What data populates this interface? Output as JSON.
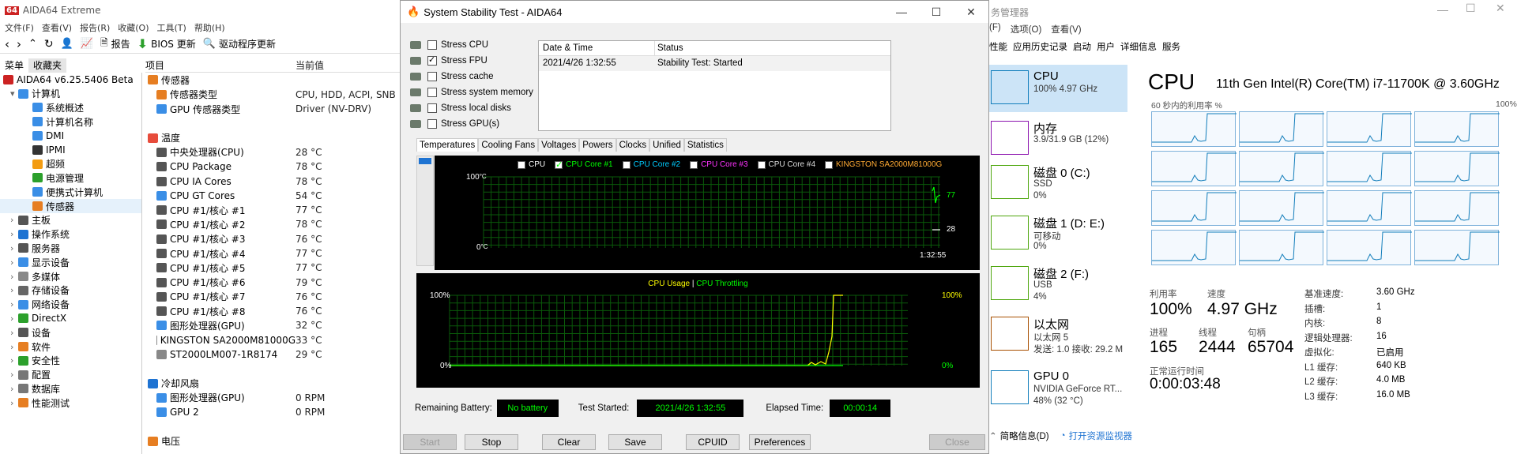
{
  "aida": {
    "title": "AIDA64 Extreme",
    "menu": [
      "文件(F)",
      "查看(V)",
      "报告(R)",
      "收藏(O)",
      "工具(T)",
      "帮助(H)"
    ],
    "toolbar": {
      "report": "报告",
      "bios": "BIOS 更新",
      "driver": "驱动程序更新"
    },
    "panel_tabs": [
      "菜单",
      "收藏夹"
    ],
    "tree": [
      {
        "label": "AIDA64 v6.25.5406 Beta",
        "indent": 0,
        "icon": "aida-logo-icon",
        "color": "#c22"
      },
      {
        "label": "计算机",
        "indent": 1,
        "icon": "computer-icon",
        "color": "#3a8ee6",
        "exp": "▾"
      },
      {
        "label": "系统概述",
        "indent": 3,
        "icon": "computer-icon",
        "color": "#3a8ee6"
      },
      {
        "label": "计算机名称",
        "indent": 3,
        "icon": "computer-icon",
        "color": "#3a8ee6"
      },
      {
        "label": "DMI",
        "indent": 3,
        "icon": "chip-icon",
        "color": "#3a8ee6"
      },
      {
        "label": "IPMI",
        "indent": 3,
        "icon": "ipmi-icon",
        "color": "#333"
      },
      {
        "label": "超频",
        "indent": 3,
        "icon": "flame-icon",
        "color": "#f39c12"
      },
      {
        "label": "电源管理",
        "indent": 3,
        "icon": "power-icon",
        "color": "#2ca02c"
      },
      {
        "label": "便携式计算机",
        "indent": 3,
        "icon": "laptop-icon",
        "color": "#3a8ee6"
      },
      {
        "label": "传感器",
        "indent": 3,
        "icon": "sensor-icon",
        "color": "#e67e22",
        "selected": true
      },
      {
        "label": "主板",
        "indent": 1,
        "icon": "motherboard-icon",
        "color": "#555",
        "exp": "›"
      },
      {
        "label": "操作系统",
        "indent": 1,
        "icon": "windows-icon",
        "color": "#1e73d2",
        "exp": "›"
      },
      {
        "label": "服务器",
        "indent": 1,
        "icon": "server-icon",
        "color": "#555",
        "exp": "›"
      },
      {
        "label": "显示设备",
        "indent": 1,
        "icon": "display-icon",
        "color": "#3a8ee6",
        "exp": "›"
      },
      {
        "label": "多媒体",
        "indent": 1,
        "icon": "media-icon",
        "color": "#888",
        "exp": "›"
      },
      {
        "label": "存储设备",
        "indent": 1,
        "icon": "storage-icon",
        "color": "#666",
        "exp": "›"
      },
      {
        "label": "网络设备",
        "indent": 1,
        "icon": "network-icon",
        "color": "#3a8ee6",
        "exp": "›"
      },
      {
        "label": "DirectX",
        "indent": 1,
        "icon": "directx-icon",
        "color": "#2ca02c",
        "exp": "›"
      },
      {
        "label": "设备",
        "indent": 1,
        "icon": "device-icon",
        "color": "#555",
        "exp": "›"
      },
      {
        "label": "软件",
        "indent": 1,
        "icon": "software-icon",
        "color": "#e67e22",
        "exp": "›"
      },
      {
        "label": "安全性",
        "indent": 1,
        "icon": "shield-icon",
        "color": "#2ca02c",
        "exp": "›"
      },
      {
        "label": "配置",
        "indent": 1,
        "icon": "config-icon",
        "color": "#777",
        "exp": "›"
      },
      {
        "label": "数据库",
        "indent": 1,
        "icon": "database-icon",
        "color": "#777",
        "exp": "›"
      },
      {
        "label": "性能测试",
        "indent": 1,
        "icon": "benchmark-icon",
        "color": "#e67e22",
        "exp": "›"
      }
    ],
    "list_headers": [
      "项目",
      "当前值"
    ],
    "list": [
      {
        "k": "传感器",
        "v": "",
        "type": "group",
        "icon": "sensor-icon",
        "color": "#e67e22"
      },
      {
        "k": "传感器类型",
        "v": "CPU, HDD, ACPI, SNB",
        "icon": "sensor-icon",
        "color": "#e67e22"
      },
      {
        "k": "GPU 传感器类型",
        "v": "Driver  (NV-DRV)",
        "icon": "gpu-icon",
        "color": "#3a8ee6"
      },
      {
        "k": "",
        "v": "",
        "type": "blank"
      },
      {
        "k": "温度",
        "v": "",
        "type": "group",
        "icon": "thermometer-icon",
        "color": "#e74c3c"
      },
      {
        "k": "中央处理器(CPU)",
        "v": "28 °C",
        "icon": "cpu-icon",
        "color": "#555"
      },
      {
        "k": "CPU Package",
        "v": "78 °C",
        "icon": "cpu-icon",
        "color": "#555"
      },
      {
        "k": "CPU IA Cores",
        "v": "78 °C",
        "icon": "cpu-icon",
        "color": "#555"
      },
      {
        "k": "CPU GT Cores",
        "v": "54 °C",
        "icon": "gpu-icon",
        "color": "#3a8ee6"
      },
      {
        "k": "CPU #1/核心 #1",
        "v": "77 °C",
        "icon": "cpu-icon",
        "color": "#555"
      },
      {
        "k": "CPU #1/核心 #2",
        "v": "78 °C",
        "icon": "cpu-icon",
        "color": "#555"
      },
      {
        "k": "CPU #1/核心 #3",
        "v": "76 °C",
        "icon": "cpu-icon",
        "color": "#555"
      },
      {
        "k": "CPU #1/核心 #4",
        "v": "77 °C",
        "icon": "cpu-icon",
        "color": "#555"
      },
      {
        "k": "CPU #1/核心 #5",
        "v": "77 °C",
        "icon": "cpu-icon",
        "color": "#555"
      },
      {
        "k": "CPU #1/核心 #6",
        "v": "79 °C",
        "icon": "cpu-icon",
        "color": "#555"
      },
      {
        "k": "CPU #1/核心 #7",
        "v": "76 °C",
        "icon": "cpu-icon",
        "color": "#555"
      },
      {
        "k": "CPU #1/核心 #8",
        "v": "76 °C",
        "icon": "cpu-icon",
        "color": "#555"
      },
      {
        "k": "图形处理器(GPU)",
        "v": "32 °C",
        "icon": "gpu-icon",
        "color": "#3a8ee6"
      },
      {
        "k": "KINGSTON SA2000M81000G",
        "v": "33 °C",
        "icon": "disk-icon",
        "color": "#888"
      },
      {
        "k": "ST2000LM007-1R8174",
        "v": "29 °C",
        "icon": "disk-icon",
        "color": "#888"
      },
      {
        "k": "",
        "v": "",
        "type": "blank"
      },
      {
        "k": "冷却风扇",
        "v": "",
        "type": "group",
        "icon": "fan-icon",
        "color": "#1e73d2"
      },
      {
        "k": "图形处理器(GPU)",
        "v": "0 RPM",
        "icon": "gpu-icon",
        "color": "#3a8ee6"
      },
      {
        "k": "GPU 2",
        "v": "0 RPM",
        "icon": "gpu-icon",
        "color": "#3a8ee6"
      },
      {
        "k": "",
        "v": "",
        "type": "blank"
      },
      {
        "k": "电压",
        "v": "",
        "type": "group",
        "icon": "voltage-icon",
        "color": "#e67e22"
      }
    ]
  },
  "sst": {
    "title": "System Stability Test - AIDA64",
    "options": [
      {
        "label": "Stress CPU",
        "checked": false
      },
      {
        "label": "Stress FPU",
        "checked": true
      },
      {
        "label": "Stress cache",
        "checked": false
      },
      {
        "label": "Stress system memory",
        "checked": false
      },
      {
        "label": "Stress local disks",
        "checked": false
      },
      {
        "label": "Stress GPU(s)",
        "checked": false
      }
    ],
    "log_headers": [
      "Date & Time",
      "Status"
    ],
    "log_rows": [
      {
        "time": "2021/4/26 1:32:55",
        "status": "Stability Test: Started"
      }
    ],
    "tabs": [
      "Temperatures",
      "Cooling Fans",
      "Voltages",
      "Powers",
      "Clocks",
      "Unified",
      "Statistics"
    ],
    "temp_legend": [
      {
        "label": "CPU",
        "checked": true,
        "color": "#ffffff"
      },
      {
        "label": "CPU Core #1",
        "checked": true,
        "color": "#00ff00"
      },
      {
        "label": "CPU Core #2",
        "checked": false,
        "color": "#00ccff"
      },
      {
        "label": "CPU Core #3",
        "checked": false,
        "color": "#ff33ff"
      },
      {
        "label": "CPU Core #4",
        "checked": false,
        "color": "#dddddd"
      },
      {
        "label": "KINGSTON SA2000M81000G",
        "checked": false,
        "color": "#ffaa33"
      }
    ],
    "temp_graph": {
      "ymax": "100",
      "yunit": "°C",
      "ymin": "0",
      "val_hi": "77",
      "val_lo": "28",
      "time": "1:32:55"
    },
    "usage_graph": {
      "title_a": "CPU Usage",
      "sep": "|",
      "title_b": "CPU Throttling",
      "ymax": "100%",
      "ymin": "0%",
      "right_hi": "100%",
      "right_lo": "0%"
    },
    "bottom": {
      "battery_label": "Remaining Battery:",
      "battery": "No battery",
      "started_label": "Test Started:",
      "started": "2021/4/26 1:32:55",
      "elapsed_label": "Elapsed Time:",
      "elapsed": "00:00:14"
    },
    "buttons": {
      "start": "Start",
      "stop": "Stop",
      "clear": "Clear",
      "save": "Save",
      "cpuid": "CPUID",
      "prefs": "Preferences",
      "close": "Close"
    }
  },
  "tm": {
    "title": "务管理器",
    "menu": [
      "(F)",
      "选项(O)",
      "查看(V)"
    ],
    "tabs": [
      "性能",
      "应用历史记录",
      "启动",
      "用户",
      "详细信息",
      "服务"
    ],
    "side": [
      {
        "t1": "CPU",
        "t2": "100%  4.97 GHz",
        "t3": "",
        "color": "#117dbb"
      },
      {
        "t1": "内存",
        "t2": "3.9/31.9 GB (12%)",
        "t3": "",
        "color": "#8b12ae"
      },
      {
        "t1": "磁盘 0 (C:)",
        "t2": "SSD",
        "t3": "0%",
        "color": "#4da60c"
      },
      {
        "t1": "磁盘 1 (D: E:)",
        "t2": "可移动",
        "t3": "0%",
        "color": "#4da60c"
      },
      {
        "t1": "磁盘 2 (F:)",
        "t2": "USB",
        "t3": "4%",
        "color": "#4da60c"
      },
      {
        "t1": "以太网",
        "t2": "以太网 5",
        "t3": "发送: 1.0  接收: 29.2 M",
        "color": "#a74f01"
      },
      {
        "t1": "GPU 0",
        "t2": "NVIDIA GeForce RT...",
        "t3": "48% (32 °C)",
        "color": "#117dbb"
      }
    ],
    "cpu_title": "CPU",
    "cpu_model": "11th Gen Intel(R) Core(TM) i7-11700K @ 3.60GHz",
    "util_label": "60 秒内的利用率 %",
    "util_max": "100%",
    "stats": {
      "util_l": "利用率",
      "util_v": "100%",
      "speed_l": "速度",
      "speed_v": "4.97 GHz",
      "proc_l": "进程",
      "proc_v": "165",
      "thr_l": "线程",
      "thr_v": "2444",
      "hdl_l": "句柄",
      "hdl_v": "65704",
      "up_l": "正常运行时间",
      "up_v": "0:00:03:48"
    },
    "kv": [
      {
        "k": "基准速度:",
        "v": "3.60 GHz"
      },
      {
        "k": "插槽:",
        "v": "1"
      },
      {
        "k": "内核:",
        "v": "8"
      },
      {
        "k": "逻辑处理器:",
        "v": "16"
      },
      {
        "k": "虚拟化:",
        "v": "已启用"
      },
      {
        "k": "L1 缓存:",
        "v": "640 KB"
      },
      {
        "k": "L2 缓存:",
        "v": "4.0 MB"
      },
      {
        "k": "L3 缓存:",
        "v": "16.0 MB"
      }
    ],
    "footer": {
      "summary": "简略信息(D)",
      "monitor": "打开资源监视器"
    }
  }
}
